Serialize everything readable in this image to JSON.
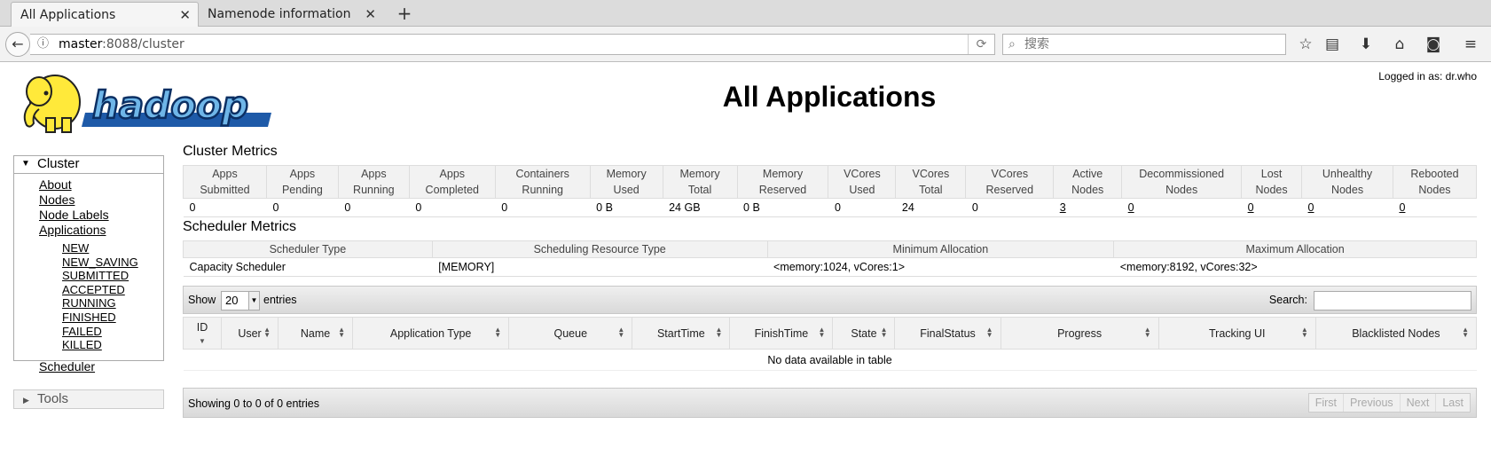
{
  "browser": {
    "tabs": [
      {
        "label": "All Applications",
        "active": true
      },
      {
        "label": "Namenode information",
        "active": false
      }
    ],
    "new_tab_label": "+",
    "url_host": "master",
    "url_rest": ":8088/cluster",
    "search_placeholder": "搜索"
  },
  "page": {
    "logged_in": "Logged in as: dr.who",
    "logo_text": "hadoop",
    "title": "All Applications"
  },
  "sidebar": {
    "cluster_label": "Cluster",
    "cluster_links": [
      "About",
      "Nodes",
      "Node Labels",
      "Applications"
    ],
    "app_states": [
      "NEW",
      "NEW_SAVING",
      "SUBMITTED",
      "ACCEPTED",
      "RUNNING",
      "FINISHED",
      "FAILED",
      "KILLED"
    ],
    "scheduler_link": "Scheduler",
    "tools_label": "Tools"
  },
  "cluster_metrics": {
    "title": "Cluster Metrics",
    "headers": [
      [
        "Apps",
        "Submitted"
      ],
      [
        "Apps",
        "Pending"
      ],
      [
        "Apps",
        "Running"
      ],
      [
        "Apps",
        "Completed"
      ],
      [
        "Containers",
        "Running"
      ],
      [
        "Memory",
        "Used"
      ],
      [
        "Memory",
        "Total"
      ],
      [
        "Memory",
        "Reserved"
      ],
      [
        "VCores",
        "Used"
      ],
      [
        "VCores",
        "Total"
      ],
      [
        "VCores",
        "Reserved"
      ],
      [
        "Active",
        "Nodes"
      ],
      [
        "Decommissioned",
        "Nodes"
      ],
      [
        "Lost",
        "Nodes"
      ],
      [
        "Unhealthy",
        "Nodes"
      ],
      [
        "Rebooted",
        "Nodes"
      ]
    ],
    "values": [
      "0",
      "0",
      "0",
      "0",
      "0",
      "0 B",
      "24 GB",
      "0 B",
      "0",
      "24",
      "0",
      "3",
      "0",
      "0",
      "0",
      "0"
    ]
  },
  "scheduler_metrics": {
    "title": "Scheduler Metrics",
    "headers": [
      "Scheduler Type",
      "Scheduling Resource Type",
      "Minimum Allocation",
      "Maximum Allocation"
    ],
    "values": [
      "Capacity Scheduler",
      "[MEMORY]",
      "<memory:1024, vCores:1>",
      "<memory:8192, vCores:32>"
    ]
  },
  "apps_table": {
    "show_label": "Show",
    "page_size": "20",
    "entries_label": "entries",
    "search_label": "Search:",
    "columns": [
      "ID",
      "User",
      "Name",
      "Application Type",
      "Queue",
      "StartTime",
      "FinishTime",
      "State",
      "FinalStatus",
      "Progress",
      "Tracking UI",
      "Blacklisted Nodes"
    ],
    "empty_message": "No data available in table",
    "info": "Showing 0 to 0 of 0 entries",
    "pager": [
      "First",
      "Previous",
      "Next",
      "Last"
    ]
  }
}
